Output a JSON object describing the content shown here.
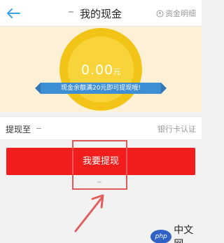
{
  "header": {
    "title": "我的现金",
    "detail_label": "资金明细"
  },
  "balance": {
    "amount": "0.00",
    "unit": "元",
    "notice": "现金余额满20元即可提现哦!"
  },
  "withdraw_row": {
    "label": "提现至",
    "link": "银行卡认证"
  },
  "action": {
    "button_label": "我要提现"
  },
  "watermark": {
    "badge": "php",
    "text": "中文网"
  },
  "colors": {
    "primary_button": "#f21d1d",
    "back_arrow": "#3aa3e3",
    "coin": "#f2c418",
    "ribbon": "#3e8ed4",
    "highlight": "#e05a5a"
  }
}
